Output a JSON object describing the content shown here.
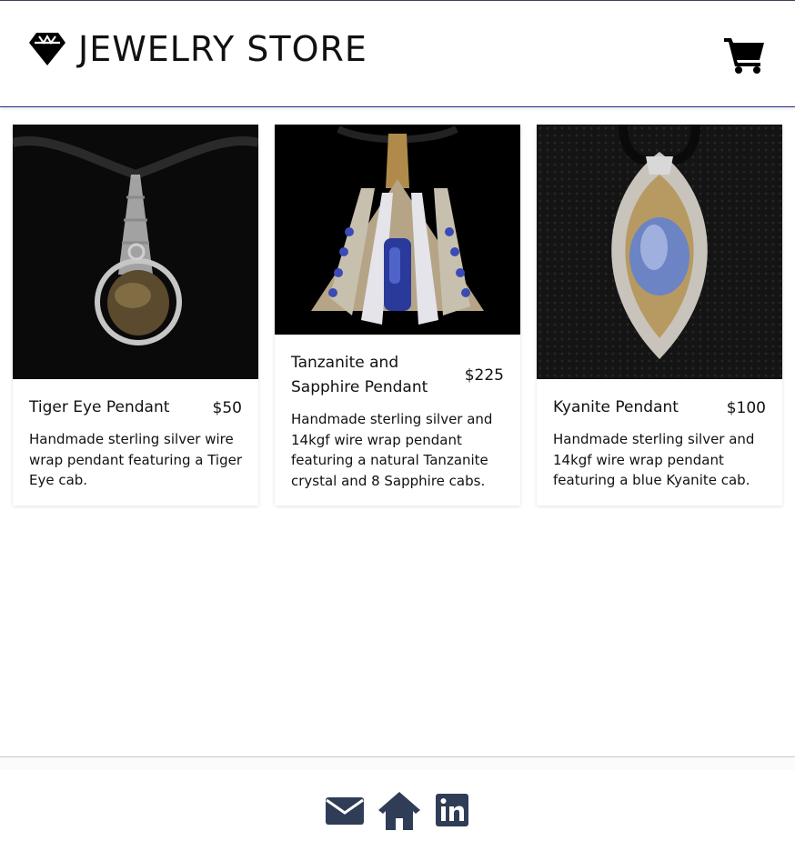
{
  "header": {
    "title": "JEWELRY STORE",
    "logo_icon": "gem-icon",
    "cart_icon": "shopping-cart-icon"
  },
  "products": [
    {
      "name": "Tiger Eye Pendant",
      "price": "$50",
      "description": "Handmade sterling silver wire wrap pendant featuring a Tiger Eye cab."
    },
    {
      "name": "Tanzanite and Sapphire Pendant",
      "price": "$225",
      "description": "Handmade sterling silver and 14kgf wire wrap pendant featuring a natural Tanzanite crystal and 8 Sapphire cabs."
    },
    {
      "name": "Kyanite Pendant",
      "price": "$100",
      "description": "Handmade sterling silver and 14kgf wire wrap pendant featuring a blue Kyanite cab."
    }
  ],
  "footer": {
    "icons": [
      "envelope-icon",
      "home-icon",
      "linkedin-icon"
    ]
  },
  "colors": {
    "footer_icon": "#2f3d56",
    "header_border": "#1f2a8a"
  }
}
